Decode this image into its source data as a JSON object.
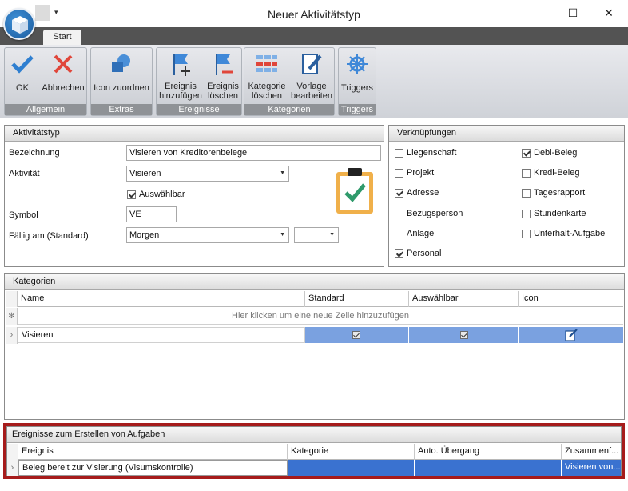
{
  "window": {
    "title": "Neuer Aktivitätstyp",
    "qat_arrow": "▾",
    "minimize": "—",
    "maximize": "☐",
    "close": "✕"
  },
  "ribbon": {
    "tab": "Start",
    "groups": {
      "allgemein": "Allgemein",
      "extras": "Extras",
      "ereignisse": "Ereignisse",
      "kategorien": "Kategorien",
      "triggers": "Triggers"
    },
    "buttons": {
      "ok": "OK",
      "abbrechen": "Abbrechen",
      "icon_zuordnen": "Icon zuordnen",
      "ereignis_hinzufuegen_1": "Ereignis",
      "ereignis_hinzufuegen_2": "hinzufügen",
      "ereignis_loeschen_1": "Ereignis",
      "ereignis_loeschen_2": "löschen",
      "kategorie_loeschen_1": "Kategorie",
      "kategorie_loeschen_2": "löschen",
      "vorlage_bearbeiten_1": "Vorlage",
      "vorlage_bearbeiten_2": "bearbeiten",
      "triggers": "Triggers"
    }
  },
  "aktivitaetstyp": {
    "header": "Aktivitätstyp",
    "bezeichnung_label": "Bezeichnung",
    "bezeichnung_value": "Visieren von Kreditorenbelege",
    "aktivitaet_label": "Aktivität",
    "aktivitaet_value": "Visieren",
    "auswaehlbar_label": "Auswählbar",
    "auswaehlbar_checked": true,
    "symbol_label": "Symbol",
    "symbol_value": "VE",
    "faellig_label": "Fällig am (Standard)",
    "faellig_value": "Morgen",
    "faellig_extra_value": ""
  },
  "verknuepfungen": {
    "header": "Verknüpfungen",
    "left": [
      {
        "label": "Liegenschaft",
        "checked": false
      },
      {
        "label": "Projekt",
        "checked": false
      },
      {
        "label": "Adresse",
        "checked": true
      },
      {
        "label": "Bezugsperson",
        "checked": false
      },
      {
        "label": "Anlage",
        "checked": false
      },
      {
        "label": "Personal",
        "checked": true
      }
    ],
    "right": [
      {
        "label": "Debi-Beleg",
        "checked": true
      },
      {
        "label": "Kredi-Beleg",
        "checked": false
      },
      {
        "label": "Tagesrapport",
        "checked": false
      },
      {
        "label": "Stundenkarte",
        "checked": false
      },
      {
        "label": "Unterhalt-Aufgabe",
        "checked": false
      }
    ]
  },
  "kategorien": {
    "header": "Kategorien",
    "columns": [
      "Name",
      "Standard",
      "Auswählbar",
      "Icon"
    ],
    "new_row_hint": "Hier klicken um eine neue Zeile hinzuzufügen",
    "rows": [
      {
        "name": "Visieren",
        "standard": true,
        "auswaehlbar": true,
        "icon": "edit-icon"
      }
    ]
  },
  "ereignisse": {
    "header": "Ereignisse zum Erstellen von Aufgaben",
    "columns": [
      "Ereignis",
      "Kategorie",
      "Auto. Übergang",
      "Zusammenf..."
    ],
    "rows": [
      {
        "ereignis": "Beleg bereit zur Visierung (Visumskontrolle)",
        "kategorie": "",
        "auto_uebergang": "",
        "zusammenfassung": "Visieren von..."
      }
    ]
  },
  "colors": {
    "ribbon_group_label": "#8f9296",
    "selection_light": "#7aa1e0",
    "selection_dark": "#3a72d0",
    "highlight_frame": "#a61b1b",
    "clipboard_orange": "#f0b04a",
    "check_green": "#2f9a6b"
  }
}
